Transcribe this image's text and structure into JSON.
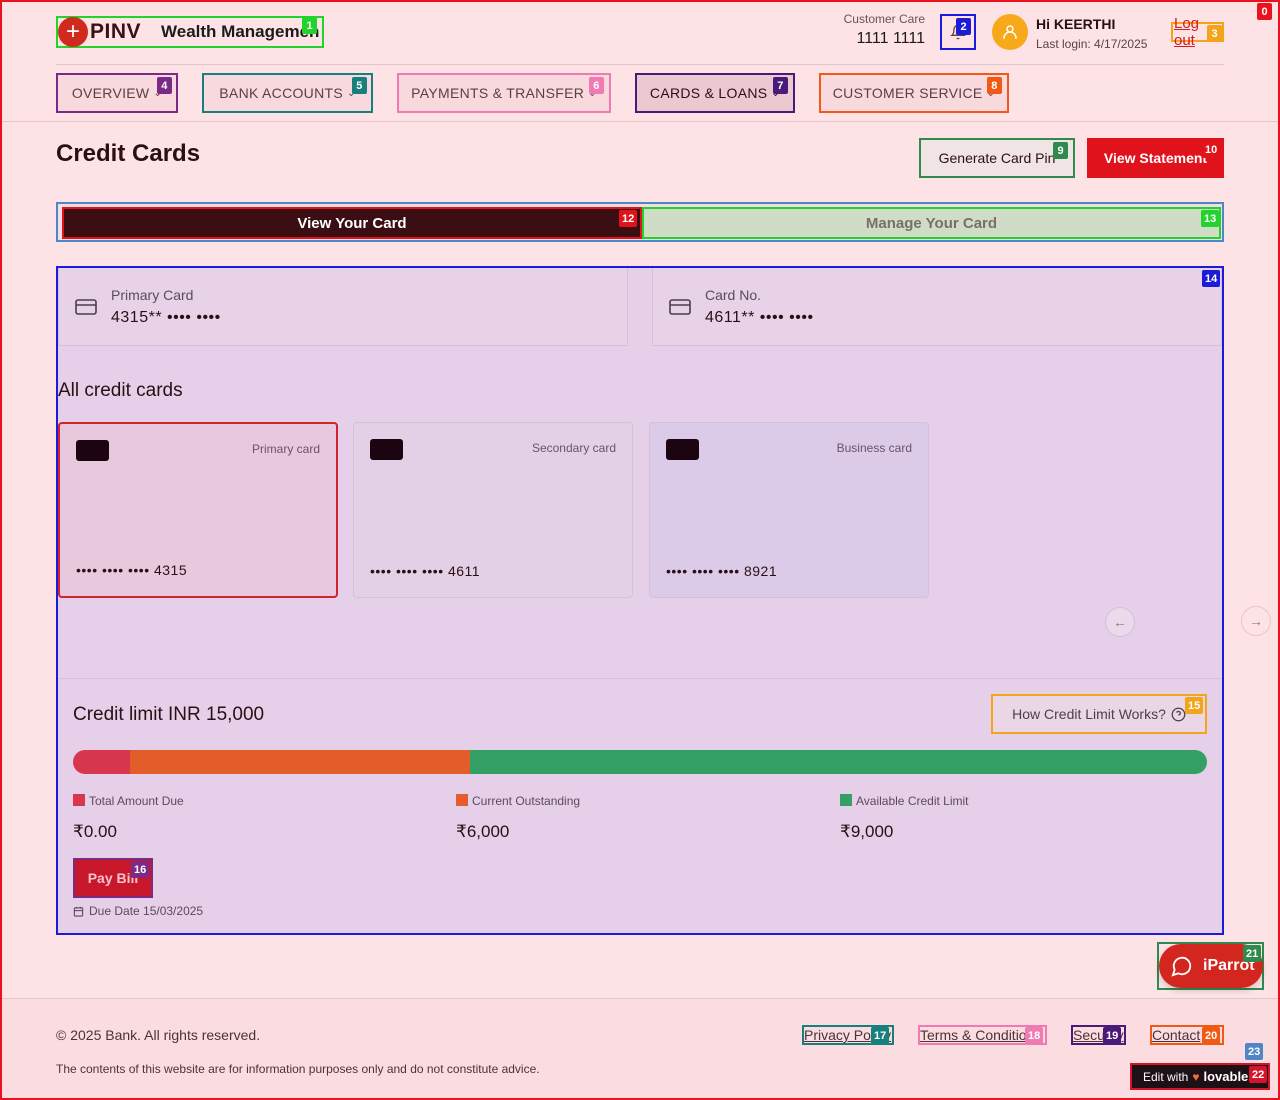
{
  "brand": {
    "logo_text": "PINV",
    "subtitle": "Wealth Management"
  },
  "header": {
    "care_label": "Customer Care",
    "care_number": "1111 1111",
    "greeting": "Hi KEERTHI",
    "last_login": "Last login: 4/17/2025",
    "logout_label": "Log out"
  },
  "nav": {
    "items": [
      {
        "label": "OVERVIEW"
      },
      {
        "label": "BANK ACCOUNTS"
      },
      {
        "label": "PAYMENTS & TRANSFER"
      },
      {
        "label": "CARDS & LOANS"
      },
      {
        "label": "CUSTOMER SERVICE"
      }
    ]
  },
  "page": {
    "title": "Credit Cards",
    "generate_pin_label": "Generate Card Pin",
    "view_statement_label": "View Statement"
  },
  "tabs": {
    "view": "View Your Card",
    "manage": "Manage Your Card"
  },
  "summary": {
    "primary_label": "Primary Card",
    "primary_value": "4315** •••• ••••",
    "cardno_label": "Card No.",
    "cardno_value": "4611** •••• ••••"
  },
  "cards": {
    "heading": "All credit cards",
    "items": [
      {
        "type": "Primary card",
        "number": "•••• •••• •••• 4315"
      },
      {
        "type": "Secondary card",
        "number": "•••• •••• •••• 4611"
      },
      {
        "type": "Business card",
        "number": "•••• •••• •••• 8921"
      }
    ]
  },
  "credit": {
    "title": "Credit limit INR 15,000",
    "how_label": "How Credit Limit Works?",
    "bar": {
      "total_due_pct": 5,
      "outstanding_pct": 30,
      "available_pct": 65
    },
    "legend": [
      {
        "label": "Total Amount Due",
        "value": "₹0.00",
        "color": "#d8364e"
      },
      {
        "label": "Current Outstanding",
        "value": "₹6,000",
        "color": "#e35d2a"
      },
      {
        "label": "Available Credit Limit",
        "value": "₹9,000",
        "color": "#34a065"
      }
    ],
    "pay_label": "Pay Bill",
    "due_date": "Due Date 15/03/2025"
  },
  "chat": {
    "label": "iParrot"
  },
  "footer": {
    "copyright": "© 2025 Bank. All rights reserved.",
    "disclaimer": "The contents of this website are for information purposes only and do not constitute advice.",
    "links": [
      "Privacy Policy",
      "Terms & Conditions",
      "Security",
      "Contact"
    ],
    "lovable_prefix": "Edit with",
    "lovable_brand": "lovable"
  },
  "colors": {
    "primary_red": "#e0131c",
    "dark_maroon": "#3b0e13",
    "accent_orange": "#f6a91a"
  },
  "marks": [
    "0",
    "1",
    "2",
    "3",
    "4",
    "5",
    "6",
    "7",
    "8",
    "9",
    "10",
    "12",
    "13",
    "14",
    "15",
    "16",
    "17",
    "18",
    "19",
    "20",
    "21",
    "22",
    "23"
  ]
}
